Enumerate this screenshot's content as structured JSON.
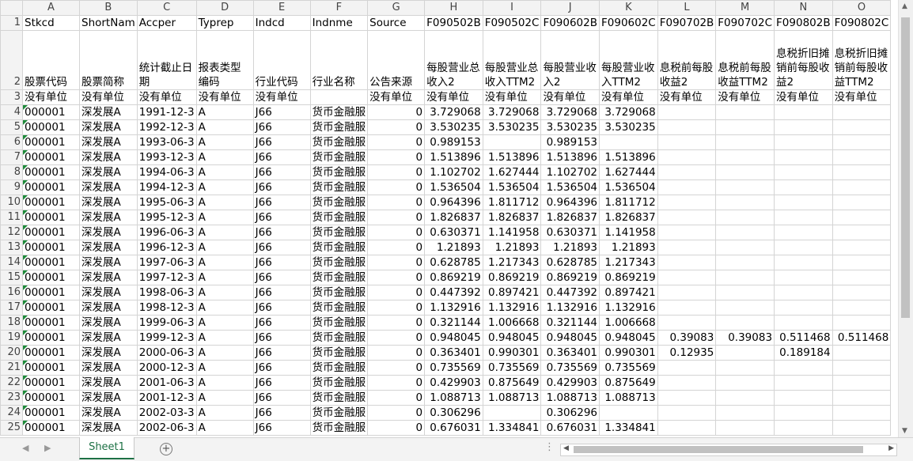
{
  "columns": [
    "A",
    "B",
    "C",
    "D",
    "E",
    "F",
    "G",
    "H",
    "I",
    "J",
    "K",
    "L",
    "M",
    "N",
    "O"
  ],
  "header_row1": [
    "Stkcd",
    "ShortNam",
    "Accper",
    "Typrep",
    "Indcd",
    "Indnme",
    "Source",
    "F090502B",
    "F090502C",
    "F090602B",
    "F090602C",
    "F090702B",
    "F090702C",
    "F090802B",
    "F090802C"
  ],
  "header_row2": [
    "股票代码",
    "股票简称",
    "统计截止日期",
    "报表类型编码",
    "行业代码",
    "行业名称",
    "公告来源",
    "每股营业总收入2",
    "每股营业总收入TTM2",
    "每股营业收入2",
    "每股营业收入TTM2",
    "息税前每股收益2",
    "息税前每股收益TTM2",
    "息税折旧摊销前每股收益2",
    "息税折旧摊销前每股收益TTM2"
  ],
  "header_row3": [
    "没有单位",
    "没有单位",
    "没有单位",
    "没有单位",
    "没有单位",
    "",
    "没有单位",
    "没有单位",
    "没有单位",
    "没有单位",
    "没有单位",
    "没有单位",
    "没有单位",
    "没有单位",
    "没有单位"
  ],
  "rows": [
    {
      "n": "4",
      "c": [
        "000001",
        "深发展A",
        "1991-12-3",
        "A",
        "J66",
        "货币金融服",
        "0",
        "3.729068",
        "3.729068",
        "3.729068",
        "3.729068",
        "",
        "",
        "",
        ""
      ]
    },
    {
      "n": "5",
      "c": [
        "000001",
        "深发展A",
        "1992-12-3",
        "A",
        "J66",
        "货币金融服",
        "0",
        "3.530235",
        "3.530235",
        "3.530235",
        "3.530235",
        "",
        "",
        "",
        ""
      ]
    },
    {
      "n": "6",
      "c": [
        "000001",
        "深发展A",
        "1993-06-3",
        "A",
        "J66",
        "货币金融服",
        "0",
        "0.989153",
        "",
        "0.989153",
        "",
        "",
        "",
        "",
        ""
      ]
    },
    {
      "n": "7",
      "c": [
        "000001",
        "深发展A",
        "1993-12-3",
        "A",
        "J66",
        "货币金融服",
        "0",
        "1.513896",
        "1.513896",
        "1.513896",
        "1.513896",
        "",
        "",
        "",
        ""
      ]
    },
    {
      "n": "8",
      "c": [
        "000001",
        "深发展A",
        "1994-06-3",
        "A",
        "J66",
        "货币金融服",
        "0",
        "1.102702",
        "1.627444",
        "1.102702",
        "1.627444",
        "",
        "",
        "",
        ""
      ]
    },
    {
      "n": "9",
      "c": [
        "000001",
        "深发展A",
        "1994-12-3",
        "A",
        "J66",
        "货币金融服",
        "0",
        "1.536504",
        "1.536504",
        "1.536504",
        "1.536504",
        "",
        "",
        "",
        ""
      ]
    },
    {
      "n": "10",
      "c": [
        "000001",
        "深发展A",
        "1995-06-3",
        "A",
        "J66",
        "货币金融服",
        "0",
        "0.964396",
        "1.811712",
        "0.964396",
        "1.811712",
        "",
        "",
        "",
        ""
      ]
    },
    {
      "n": "11",
      "c": [
        "000001",
        "深发展A",
        "1995-12-3",
        "A",
        "J66",
        "货币金融服",
        "0",
        "1.826837",
        "1.826837",
        "1.826837",
        "1.826837",
        "",
        "",
        "",
        ""
      ]
    },
    {
      "n": "12",
      "c": [
        "000001",
        "深发展A",
        "1996-06-3",
        "A",
        "J66",
        "货币金融服",
        "0",
        "0.630371",
        "1.141958",
        "0.630371",
        "1.141958",
        "",
        "",
        "",
        ""
      ]
    },
    {
      "n": "13",
      "c": [
        "000001",
        "深发展A",
        "1996-12-3",
        "A",
        "J66",
        "货币金融服",
        "0",
        "1.21893",
        "1.21893",
        "1.21893",
        "1.21893",
        "",
        "",
        "",
        ""
      ]
    },
    {
      "n": "14",
      "c": [
        "000001",
        "深发展A",
        "1997-06-3",
        "A",
        "J66",
        "货币金融服",
        "0",
        "0.628785",
        "1.217343",
        "0.628785",
        "1.217343",
        "",
        "",
        "",
        ""
      ]
    },
    {
      "n": "15",
      "c": [
        "000001",
        "深发展A",
        "1997-12-3",
        "A",
        "J66",
        "货币金融服",
        "0",
        "0.869219",
        "0.869219",
        "0.869219",
        "0.869219",
        "",
        "",
        "",
        ""
      ]
    },
    {
      "n": "16",
      "c": [
        "000001",
        "深发展A",
        "1998-06-3",
        "A",
        "J66",
        "货币金融服",
        "0",
        "0.447392",
        "0.897421",
        "0.447392",
        "0.897421",
        "",
        "",
        "",
        ""
      ]
    },
    {
      "n": "17",
      "c": [
        "000001",
        "深发展A",
        "1998-12-3",
        "A",
        "J66",
        "货币金融服",
        "0",
        "1.132916",
        "1.132916",
        "1.132916",
        "1.132916",
        "",
        "",
        "",
        ""
      ]
    },
    {
      "n": "18",
      "c": [
        "000001",
        "深发展A",
        "1999-06-3",
        "A",
        "J66",
        "货币金融服",
        "0",
        "0.321144",
        "1.006668",
        "0.321144",
        "1.006668",
        "",
        "",
        "",
        ""
      ]
    },
    {
      "n": "19",
      "c": [
        "000001",
        "深发展A",
        "1999-12-3",
        "A",
        "J66",
        "货币金融服",
        "0",
        "0.948045",
        "0.948045",
        "0.948045",
        "0.948045",
        "0.39083",
        "0.39083",
        "0.511468",
        "0.511468"
      ]
    },
    {
      "n": "20",
      "c": [
        "000001",
        "深发展A",
        "2000-06-3",
        "A",
        "J66",
        "货币金融服",
        "0",
        "0.363401",
        "0.990301",
        "0.363401",
        "0.990301",
        "0.12935",
        "",
        "0.189184",
        ""
      ]
    },
    {
      "n": "21",
      "c": [
        "000001",
        "深发展A",
        "2000-12-3",
        "A",
        "J66",
        "货币金融服",
        "0",
        "0.735569",
        "0.735569",
        "0.735569",
        "0.735569",
        "",
        "",
        "",
        ""
      ]
    },
    {
      "n": "22",
      "c": [
        "000001",
        "深发展A",
        "2001-06-3",
        "A",
        "J66",
        "货币金融服",
        "0",
        "0.429903",
        "0.875649",
        "0.429903",
        "0.875649",
        "",
        "",
        "",
        ""
      ]
    },
    {
      "n": "23",
      "c": [
        "000001",
        "深发展A",
        "2001-12-3",
        "A",
        "J66",
        "货币金融服",
        "0",
        "1.088713",
        "1.088713",
        "1.088713",
        "1.088713",
        "",
        "",
        "",
        ""
      ]
    },
    {
      "n": "24",
      "c": [
        "000001",
        "深发展A",
        "2002-03-3",
        "A",
        "J66",
        "货币金融服",
        "0",
        "0.306296",
        "",
        "0.306296",
        "",
        "",
        "",
        "",
        ""
      ]
    },
    {
      "n": "25",
      "c": [
        "000001",
        "深发展A",
        "2002-06-3",
        "A",
        "J66",
        "货币金融服",
        "0",
        "0.676031",
        "1.334841",
        "0.676031",
        "1.334841",
        "",
        "",
        "",
        ""
      ]
    }
  ],
  "sheet_tab": "Sheet1",
  "colors": {
    "accent": "#1e7145",
    "grid": "#d4d4d4",
    "header_bg": "#f3f3f3",
    "error_marker": "#1e8a3a"
  },
  "icons": {
    "add_sheet": "plus-circle-icon",
    "vscroll_up": "triangle-up-icon",
    "vscroll_down": "triangle-down-icon",
    "hscroll_left": "triangle-left-icon",
    "hscroll_right": "triangle-right-icon",
    "sheet_nav_prev": "chevron-left-icon",
    "sheet_nav_next": "chevron-right-icon"
  }
}
